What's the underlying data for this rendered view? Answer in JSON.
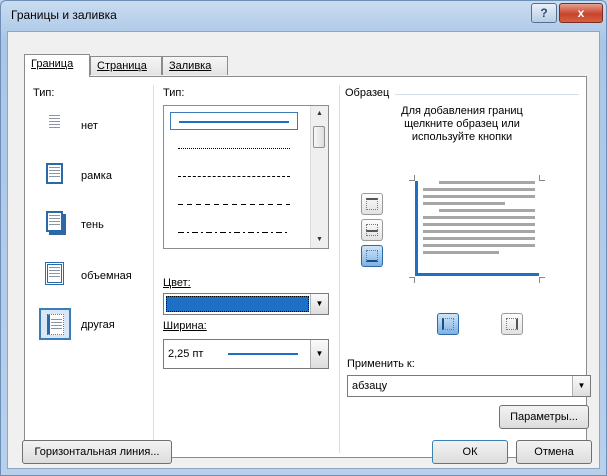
{
  "window": {
    "title": "Границы и заливка",
    "help_label": "?",
    "close_label": "x"
  },
  "tabs": [
    {
      "label": "Граница",
      "active": true
    },
    {
      "label": "Страница",
      "active": false
    },
    {
      "label": "Заливка",
      "active": false
    }
  ],
  "presets": {
    "title": "Тип:",
    "items": [
      {
        "label": "нет"
      },
      {
        "label": "рамка"
      },
      {
        "label": "тень"
      },
      {
        "label": "объемная"
      },
      {
        "label": "другая",
        "selected": true
      }
    ]
  },
  "style": {
    "title": "Тип:",
    "lines": [
      "solid",
      "dotted",
      "dashed-fine",
      "dashed",
      "dash-dot"
    ]
  },
  "color": {
    "label": "Цвет:",
    "value_color": "#1f6fc5"
  },
  "width": {
    "label": "Ширина:",
    "value": "2,25 пт"
  },
  "sample": {
    "title": "Образец",
    "hint_1": "Для добавления границ",
    "hint_2": "щелкните образец или",
    "hint_3": "используйте кнопки"
  },
  "apply": {
    "label": "Применить к:",
    "value": "абзацу"
  },
  "buttons": {
    "params": "Параметры...",
    "horizontal_line": "Горизонтальная линия...",
    "ok": "ОК",
    "cancel": "Отмена"
  },
  "colors": {
    "accent": "#1f6fc5"
  }
}
